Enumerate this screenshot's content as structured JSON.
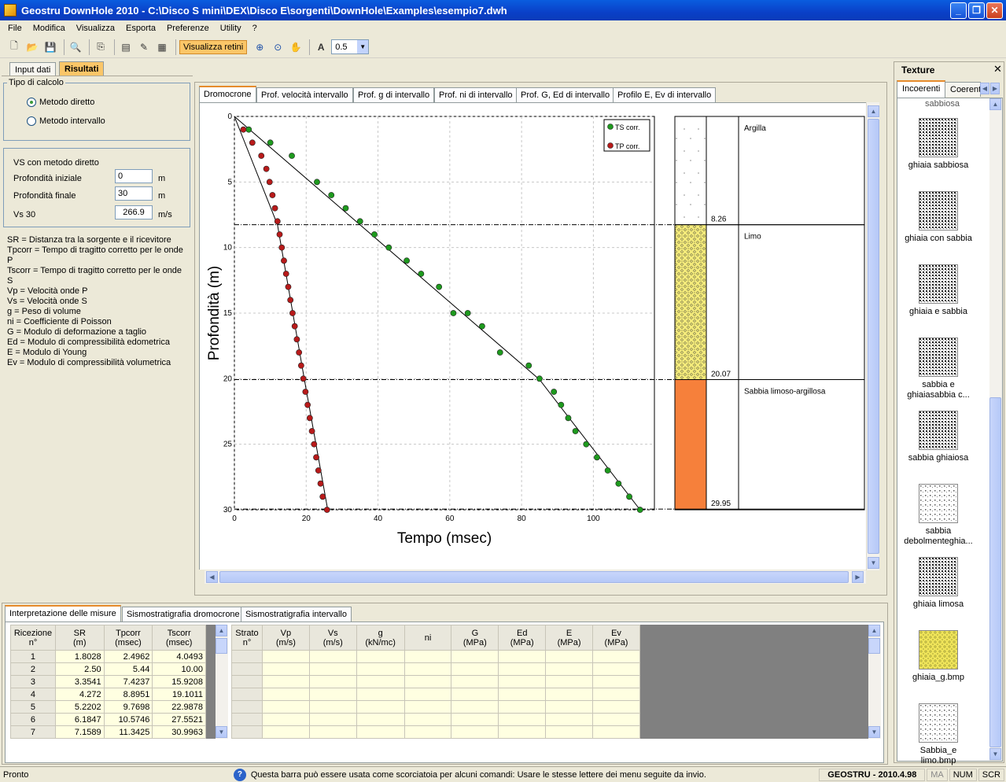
{
  "window": {
    "title": "Geostru DownHole 2010 - C:\\Disco S mini\\DEX\\Disco E\\sorgenti\\DownHole\\Examples\\esempio7.dwh"
  },
  "menu": [
    "File",
    "Modifica",
    "Visualizza",
    "Esporta",
    "Preferenze",
    "Utility",
    "?"
  ],
  "toolbar": {
    "visualizza_label": "Visualizza retini",
    "zoom_value": "0.5"
  },
  "side_tabs": [
    "Input dati",
    "Risultati"
  ],
  "calc": {
    "title": "Tipo di calcolo",
    "options": [
      "Metodo diretto",
      "Metodo intervallo"
    ],
    "selected": "Metodo diretto"
  },
  "vs": {
    "title": "VS con metodo diretto",
    "prof_iniziale_label": "Profondità iniziale",
    "prof_iniziale": "0",
    "prof_iniziale_unit": "m",
    "prof_finale_label": "Profondità finale",
    "prof_finale": "30",
    "prof_finale_unit": "m",
    "vs30_label": "Vs  30",
    "vs30": "266.9",
    "vs30_unit": "m/s"
  },
  "legend_lines": [
    "SR = Distanza tra la sorgente e il ricevitore",
    "Tpcorr = Tempo di tragitto corretto per le onde P",
    "Tscorr = Tempo di tragitto corretto per le onde S",
    "Vp = Velocità onde P",
    "Vs = Velocità onde S",
    "g = Peso di volume",
    "ni = Coefficiente di Poisson",
    "G = Modulo di deformazione a taglio",
    "Ed = Modulo di compressibilità edometrica",
    "E = Modulo di Young",
    "Ev = Modulo di compressibilità volumetrica"
  ],
  "chart_tabs": [
    "Dromocrone",
    "Prof. velocità intervallo",
    "Prof. g di intervallo",
    "Prof. ni di intervallo",
    "Prof. G, Ed di intervallo",
    "Profilo E, Ev di intervallo"
  ],
  "chart_data": {
    "type": "scatter",
    "xlabel": "Tempo (msec)",
    "ylabel": "Profondità (m)",
    "xlim": [
      0,
      117
    ],
    "ylim": [
      30,
      0
    ],
    "xticks": [
      0,
      20,
      40,
      60,
      80,
      100
    ],
    "yticks": [
      0,
      5,
      10,
      15,
      20,
      25,
      30
    ],
    "grid": true,
    "legend_position": "top-right",
    "series": [
      {
        "name": "TS corr.",
        "color": "#1e9a1e",
        "points": [
          [
            4,
            1
          ],
          [
            10,
            2
          ],
          [
            16,
            3
          ],
          [
            23,
            5
          ],
          [
            27,
            6
          ],
          [
            31,
            7
          ],
          [
            35,
            8
          ],
          [
            39,
            9
          ],
          [
            43,
            10
          ],
          [
            48,
            11
          ],
          [
            52,
            12
          ],
          [
            57,
            13
          ],
          [
            61,
            15
          ],
          [
            65,
            15
          ],
          [
            69,
            16
          ],
          [
            74,
            18
          ],
          [
            82,
            19
          ],
          [
            85,
            20
          ],
          [
            89,
            21
          ],
          [
            91,
            22
          ],
          [
            93,
            23
          ],
          [
            95,
            24
          ],
          [
            98,
            25
          ],
          [
            101,
            26
          ],
          [
            104,
            27
          ],
          [
            107,
            28
          ],
          [
            110,
            29
          ],
          [
            113,
            30
          ]
        ]
      },
      {
        "name": "TP corr.",
        "color": "#b81a1a",
        "points": [
          [
            2.5,
            1
          ],
          [
            5,
            2
          ],
          [
            7.5,
            3
          ],
          [
            8.9,
            4
          ],
          [
            9.8,
            5
          ],
          [
            10.6,
            6
          ],
          [
            11.3,
            7
          ],
          [
            12,
            8
          ],
          [
            12.6,
            9
          ],
          [
            13.2,
            10
          ],
          [
            13.8,
            11
          ],
          [
            14.4,
            12
          ],
          [
            15,
            13
          ],
          [
            15.6,
            14
          ],
          [
            16.2,
            15
          ],
          [
            16.8,
            16
          ],
          [
            17.4,
            17
          ],
          [
            18,
            18
          ],
          [
            18.6,
            19
          ],
          [
            19.2,
            20
          ],
          [
            19.8,
            21
          ],
          [
            20.4,
            22
          ],
          [
            21,
            23
          ],
          [
            21.6,
            24
          ],
          [
            22.2,
            25
          ],
          [
            22.8,
            26
          ],
          [
            23.4,
            27
          ],
          [
            24,
            28
          ],
          [
            24.6,
            29
          ],
          [
            25.8,
            30
          ]
        ]
      }
    ],
    "fit_lines": [
      {
        "series": "TS corr.",
        "points": [
          [
            0,
            0
          ],
          [
            85,
            20.07
          ],
          [
            113,
            30
          ]
        ]
      },
      {
        "series": "TP corr.",
        "points": [
          [
            0,
            0
          ],
          [
            12,
            8.26
          ],
          [
            19.5,
            20.07
          ],
          [
            26,
            30
          ]
        ]
      }
    ]
  },
  "strata": [
    {
      "name": "Argilla",
      "top": 0,
      "bottom": 8.26,
      "depth_label": "8.26",
      "fill": "argilla"
    },
    {
      "name": "Limo",
      "top": 8.26,
      "bottom": 20.07,
      "depth_label": "20.07",
      "fill": "limo"
    },
    {
      "name": "Sabbia limoso-argillosa",
      "top": 20.07,
      "bottom": 29.95,
      "depth_label": "29.95",
      "fill": "sabbia",
      "color": "#f6803b"
    }
  ],
  "bottom_tabs": [
    "Interpretazione delle misure",
    "Sismostratigrafia dromocrone",
    "Sismostratigrafia intervallo"
  ],
  "meas_table": {
    "headers": [
      [
        "Ricezione",
        "n°"
      ],
      [
        "SR",
        "(m)"
      ],
      [
        "Tpcorr",
        "(msec)"
      ],
      [
        "Tscorr",
        "(msec)"
      ]
    ],
    "rows": [
      [
        "1",
        "1.8028",
        "2.4962",
        "4.0493"
      ],
      [
        "2",
        "2.50",
        "5.44",
        "10.00"
      ],
      [
        "3",
        "3.3541",
        "7.4237",
        "15.9208"
      ],
      [
        "4",
        "4.272",
        "8.8951",
        "19.1011"
      ],
      [
        "5",
        "5.2202",
        "9.7698",
        "22.9878"
      ],
      [
        "6",
        "6.1847",
        "10.5746",
        "27.5521"
      ],
      [
        "7",
        "7.1589",
        "11.3425",
        "30.9963"
      ]
    ]
  },
  "strat_table": {
    "headers": [
      [
        "Strato",
        "n°"
      ],
      [
        "Vp",
        "(m/s)"
      ],
      [
        "Vs",
        "(m/s)"
      ],
      [
        "g",
        "(kN/mc)"
      ],
      [
        "ni",
        ""
      ],
      [
        "G",
        "(MPa)"
      ],
      [
        "Ed",
        "(MPa)"
      ],
      [
        "E",
        "(MPa)"
      ],
      [
        "Ev",
        "(MPa)"
      ]
    ]
  },
  "texture": {
    "title": "Texture",
    "tabs": [
      "Incoerenti",
      "Coerenti"
    ],
    "items": [
      "ghiaia sabbiosa",
      "ghiaia con sabbia",
      "ghiaia e sabbia",
      "sabbia e ghiaiasabbia c...",
      "sabbia ghiaiosa",
      "sabbia debolmenteghia...",
      "ghiaia limosa",
      "ghiaia_g.bmp",
      "Sabbia_e limo.bmp"
    ],
    "partial_top": "sabbiosa"
  },
  "status": {
    "left": "Pronto",
    "hint": "Questa barra può essere usata come scorciatoia per alcuni comandi: Usare le stesse lettere dei menu seguite da invio.",
    "brand": "GEOSTRU - 2010.4.98",
    "ma": "MA",
    "num": "NUM",
    "scr": "SCR"
  }
}
